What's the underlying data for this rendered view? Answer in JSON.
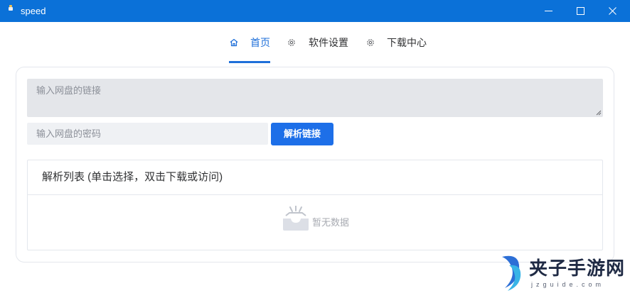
{
  "window": {
    "title": "speed",
    "titlebar_color": "#0b71d8",
    "controls": {
      "minimize_icon": "minimize-icon",
      "maximize_icon": "maximize-icon",
      "close_icon": "close-icon"
    }
  },
  "tabs": [
    {
      "label": "首页",
      "icon": "home-icon",
      "active": true
    },
    {
      "label": "软件设置",
      "icon": "gear-icon",
      "active": false
    },
    {
      "label": "下载中心",
      "icon": "gear-icon",
      "active": false
    }
  ],
  "form": {
    "link_placeholder": "输入网盘的链接",
    "password_placeholder": "输入网盘的密码",
    "parse_button": "解析链接"
  },
  "list": {
    "title": "解析列表 (单击选择，双击下载或访问)",
    "empty_text": "暂无数据",
    "empty_icon": "empty-box-icon"
  },
  "watermark": {
    "text": "夹子手游网",
    "subtext": "jzguide.com"
  },
  "colors": {
    "accent": "#1e6fd9",
    "button": "#1d6fe8"
  }
}
